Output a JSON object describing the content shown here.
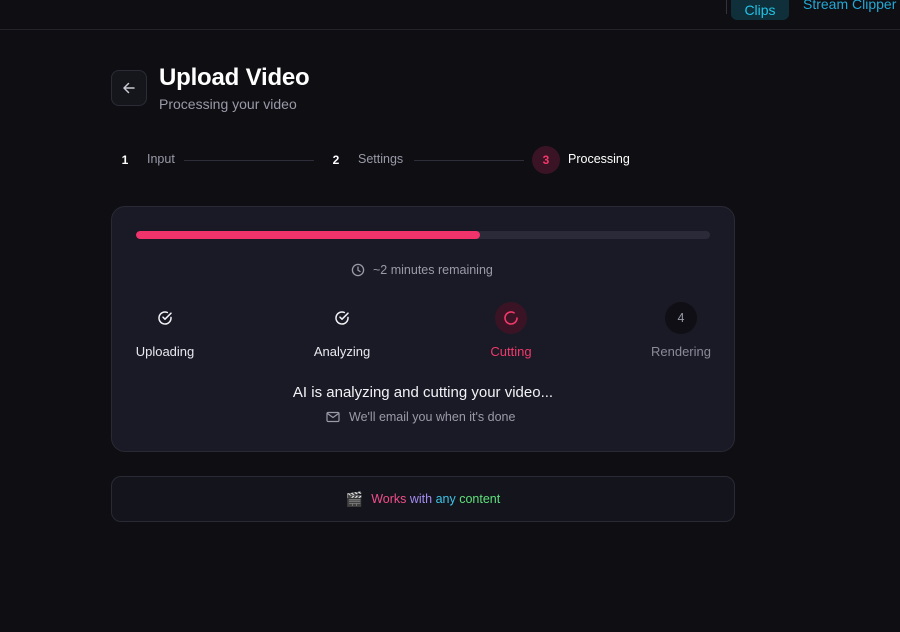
{
  "topbar": {
    "tabs": [
      {
        "label": "Clips",
        "active": true
      },
      {
        "label": "Stream Clipper",
        "active": false
      }
    ]
  },
  "header": {
    "back_icon": "arrow-left-icon",
    "title": "Upload Video",
    "subtitle": "Processing your video"
  },
  "stepper": {
    "steps": [
      {
        "number": "1",
        "label": "Input"
      },
      {
        "number": "2",
        "label": "Settings"
      },
      {
        "number": "3",
        "label": "Processing",
        "active": true
      }
    ]
  },
  "progress": {
    "fraction": 0.6,
    "remaining": "~2 minutes remaining",
    "clock_icon": "clock-icon"
  },
  "phases": [
    {
      "label": "Uploading",
      "state": "done",
      "icon": "check-circle-icon"
    },
    {
      "label": "Analyzing",
      "state": "done",
      "icon": "check-circle-icon"
    },
    {
      "label": "Cutting",
      "state": "current",
      "icon": "spinner-icon"
    },
    {
      "label": "Rendering",
      "state": "pending",
      "number": "4"
    }
  ],
  "status": {
    "main": "AI is analyzing and cutting your video...",
    "sub": "We'll email you when it's done",
    "mail_icon": "mail-icon"
  },
  "footer": {
    "emoji": "🎬",
    "words": [
      "Works",
      "with",
      "any",
      "content"
    ]
  },
  "colors": {
    "accent": "#f0336a",
    "background": "#0e0e13",
    "card": "#1a1a26"
  }
}
